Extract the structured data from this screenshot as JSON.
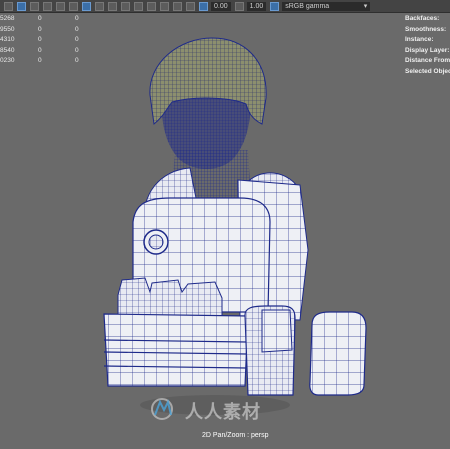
{
  "toolbar": {
    "field_value_1": "0.00",
    "field_value_2": "1.00",
    "colorspace": "sRGB gamma",
    "dropdown_arrow": "▾"
  },
  "hud_left": {
    "rows": [
      [
        "5268",
        "0",
        "0"
      ],
      [
        "9550",
        "0",
        "0"
      ],
      [
        "4310",
        "0",
        "0"
      ],
      [
        "8540",
        "0",
        "0"
      ],
      [
        "0230",
        "0",
        "0"
      ]
    ]
  },
  "hud_right": {
    "labels": [
      "Backfaces:",
      "Smoothness:",
      "Instance:",
      "Display Layer:",
      "Distance From Ca",
      "Selected Objects"
    ]
  },
  "viewport": {
    "camera_label": "2D Pan/Zoom : persp",
    "watermark_text": "人人素材"
  },
  "colors": {
    "viewport_bg": "#6a6a6a",
    "wireframe_blue": "#1e2a8a",
    "mesh_white": "#eef0f5",
    "helmet": "#8c8f6e"
  }
}
